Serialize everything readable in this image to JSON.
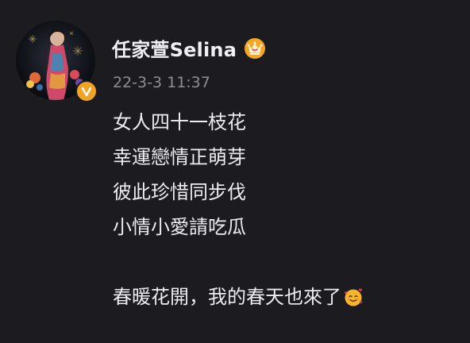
{
  "post": {
    "author": {
      "name": "任家萱Selina",
      "avatar_icon": "avatar",
      "verified_icon": "verified-v-badge-icon",
      "crown_icon": "crown-icon"
    },
    "timestamp": "22-3-3 11:37",
    "lines": [
      "女人四十一枝花",
      "幸運戀情正萌芽",
      "彼此珍惜同步伐",
      "小情小愛請吃瓜",
      "",
      "春暖花開，我的春天也來了"
    ],
    "trailing_emoji_icon": "smiling-face-with-hearts-icon"
  },
  "colors": {
    "background": "#1c1b20",
    "text": "#ececf1",
    "timestamp": "#8e8d96",
    "verified": "#f1a421",
    "crown": "#f5a623"
  }
}
